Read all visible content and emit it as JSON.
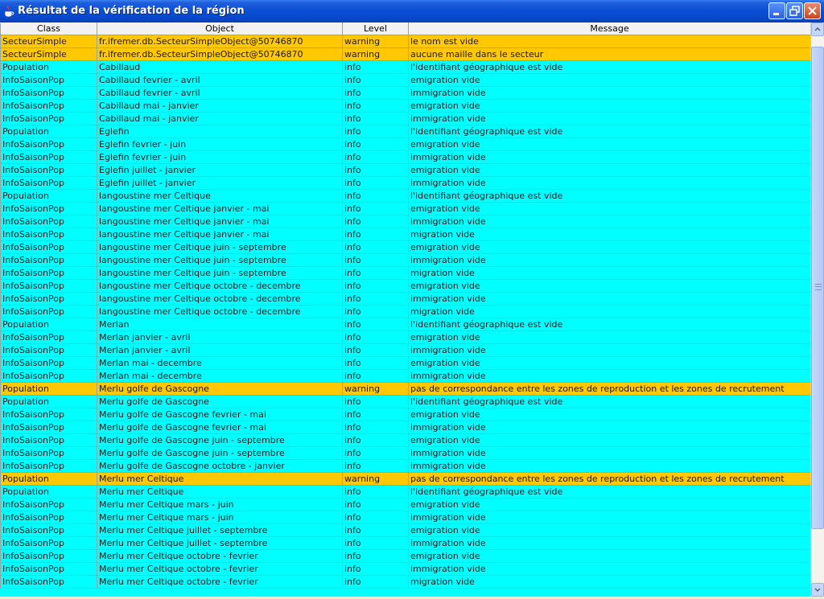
{
  "window": {
    "title": "Résultat de la vérification de la région"
  },
  "table": {
    "headers": [
      "Class",
      "Object",
      "Level",
      "Message"
    ],
    "rows": [
      {
        "cls": "SecteurSimple",
        "obj": "fr.ifremer.db.SecteurSimpleObject@50746870",
        "level": "warning",
        "msg": "le nom est vide"
      },
      {
        "cls": "SecteurSimple",
        "obj": "fr.ifremer.db.SecteurSimpleObject@50746870",
        "level": "warning",
        "msg": "aucune maille dans le secteur"
      },
      {
        "cls": "Population",
        "obj": "Cabillaud",
        "level": "info",
        "msg": "l'identifiant géographique est vide"
      },
      {
        "cls": "InfoSaisonPop",
        "obj": "Cabillaud fevrier - avril",
        "level": "info",
        "msg": "emigration vide"
      },
      {
        "cls": "InfoSaisonPop",
        "obj": "Cabillaud fevrier - avril",
        "level": "info",
        "msg": "immigration vide"
      },
      {
        "cls": "InfoSaisonPop",
        "obj": "Cabillaud mai - janvier",
        "level": "info",
        "msg": "emigration vide"
      },
      {
        "cls": "InfoSaisonPop",
        "obj": "Cabillaud mai - janvier",
        "level": "info",
        "msg": "immigration vide"
      },
      {
        "cls": "Population",
        "obj": "Eglefin",
        "level": "info",
        "msg": "l'identifiant géographique est vide"
      },
      {
        "cls": "InfoSaisonPop",
        "obj": "Eglefin fevrier - juin",
        "level": "info",
        "msg": "emigration vide"
      },
      {
        "cls": "InfoSaisonPop",
        "obj": "Eglefin fevrier - juin",
        "level": "info",
        "msg": "immigration vide"
      },
      {
        "cls": "InfoSaisonPop",
        "obj": "Eglefin juillet - janvier",
        "level": "info",
        "msg": "emigration vide"
      },
      {
        "cls": "InfoSaisonPop",
        "obj": "Eglefin juillet - janvier",
        "level": "info",
        "msg": "immigration vide"
      },
      {
        "cls": "Population",
        "obj": "langoustine mer Celtique",
        "level": "info",
        "msg": "l'identifiant géographique est vide"
      },
      {
        "cls": "InfoSaisonPop",
        "obj": "langoustine mer Celtique janvier - mai",
        "level": "info",
        "msg": "emigration vide"
      },
      {
        "cls": "InfoSaisonPop",
        "obj": "langoustine mer Celtique janvier - mai",
        "level": "info",
        "msg": "immigration vide"
      },
      {
        "cls": "InfoSaisonPop",
        "obj": "langoustine mer Celtique janvier - mai",
        "level": "info",
        "msg": "migration vide"
      },
      {
        "cls": "InfoSaisonPop",
        "obj": "langoustine mer Celtique juin - septembre",
        "level": "info",
        "msg": "emigration vide"
      },
      {
        "cls": "InfoSaisonPop",
        "obj": "langoustine mer Celtique juin - septembre",
        "level": "info",
        "msg": "immigration vide"
      },
      {
        "cls": "InfoSaisonPop",
        "obj": "langoustine mer Celtique juin - septembre",
        "level": "info",
        "msg": "migration vide"
      },
      {
        "cls": "InfoSaisonPop",
        "obj": "langoustine mer Celtique octobre - decembre",
        "level": "info",
        "msg": "emigration vide"
      },
      {
        "cls": "InfoSaisonPop",
        "obj": "langoustine mer Celtique octobre - decembre",
        "level": "info",
        "msg": "immigration vide"
      },
      {
        "cls": "InfoSaisonPop",
        "obj": "langoustine mer Celtique octobre - decembre",
        "level": "info",
        "msg": "migration vide"
      },
      {
        "cls": "Population",
        "obj": "Merlan",
        "level": "info",
        "msg": "l'identifiant géographique est vide"
      },
      {
        "cls": "InfoSaisonPop",
        "obj": "Merlan janvier - avril",
        "level": "info",
        "msg": "emigration vide"
      },
      {
        "cls": "InfoSaisonPop",
        "obj": "Merlan janvier - avril",
        "level": "info",
        "msg": "immigration vide"
      },
      {
        "cls": "InfoSaisonPop",
        "obj": "Merlan mai - decembre",
        "level": "info",
        "msg": "emigration vide"
      },
      {
        "cls": "InfoSaisonPop",
        "obj": "Merlan mai - decembre",
        "level": "info",
        "msg": "immigration vide"
      },
      {
        "cls": "Population",
        "obj": "Merlu golfe de Gascogne",
        "level": "warning",
        "msg": "pas de correspondance entre les zones de reproduction et les zones de recrutement"
      },
      {
        "cls": "Population",
        "obj": "Merlu golfe de Gascogne",
        "level": "info",
        "msg": "l'identifiant géographique est vide"
      },
      {
        "cls": "InfoSaisonPop",
        "obj": "Merlu golfe de Gascogne fevrier - mai",
        "level": "info",
        "msg": "emigration vide"
      },
      {
        "cls": "InfoSaisonPop",
        "obj": "Merlu golfe de Gascogne fevrier - mai",
        "level": "info",
        "msg": "immigration vide"
      },
      {
        "cls": "InfoSaisonPop",
        "obj": "Merlu golfe de Gascogne juin - septembre",
        "level": "info",
        "msg": "emigration vide"
      },
      {
        "cls": "InfoSaisonPop",
        "obj": "Merlu golfe de Gascogne juin - septembre",
        "level": "info",
        "msg": "immigration vide"
      },
      {
        "cls": "InfoSaisonPop",
        "obj": "Merlu golfe de Gascogne octobre - janvier",
        "level": "info",
        "msg": "immigration vide"
      },
      {
        "cls": "Population",
        "obj": "Merlu mer Celtique",
        "level": "warning",
        "msg": "pas de correspondance entre les zones de reproduction et les zones de recrutement"
      },
      {
        "cls": "Population",
        "obj": "Merlu mer Celtique",
        "level": "info",
        "msg": "l'identifiant géographique est vide"
      },
      {
        "cls": "InfoSaisonPop",
        "obj": "Merlu mer Celtique mars - juin",
        "level": "info",
        "msg": "emigration vide"
      },
      {
        "cls": "InfoSaisonPop",
        "obj": "Merlu mer Celtique mars - juin",
        "level": "info",
        "msg": "immigration vide"
      },
      {
        "cls": "InfoSaisonPop",
        "obj": "Merlu mer Celtique juillet - septembre",
        "level": "info",
        "msg": "emigration vide"
      },
      {
        "cls": "InfoSaisonPop",
        "obj": "Merlu mer Celtique juillet - septembre",
        "level": "info",
        "msg": "immigration vide"
      },
      {
        "cls": "InfoSaisonPop",
        "obj": "Merlu mer Celtique octobre - fevrier",
        "level": "info",
        "msg": "emigration vide"
      },
      {
        "cls": "InfoSaisonPop",
        "obj": "Merlu mer Celtique octobre - fevrier",
        "level": "info",
        "msg": "immigration vide"
      },
      {
        "cls": "InfoSaisonPop",
        "obj": "Merlu mer Celtique octobre - fevrier",
        "level": "info",
        "msg": "migration vide"
      }
    ]
  },
  "colors": {
    "info_row": "#00ffff",
    "warning_row": "#ffc800"
  }
}
